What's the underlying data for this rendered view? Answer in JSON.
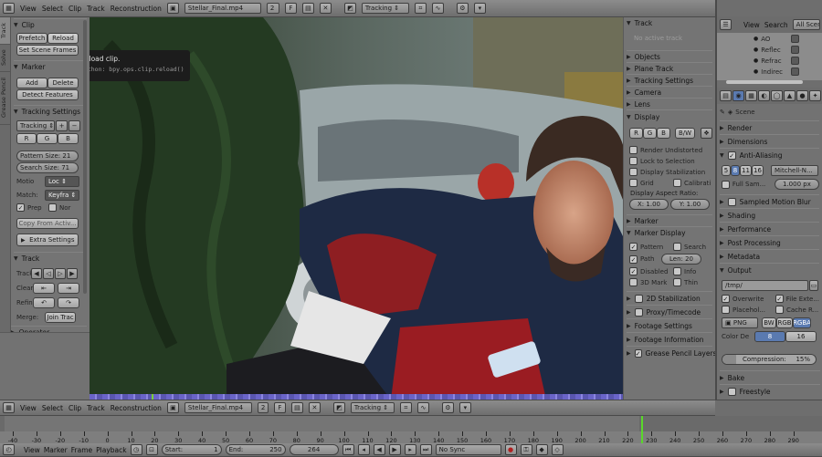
{
  "top_header": {
    "menus": [
      "View",
      "Select",
      "Clip",
      "Track",
      "Reconstruction"
    ],
    "clip_name": "Stellar_Final.mp4",
    "clip_users": "2",
    "mode": "Tracking"
  },
  "left_tabs": [
    "Track",
    "Solve",
    "Grease Pencil"
  ],
  "tool_panel": {
    "clip": {
      "title": "Clip",
      "prefetch": "Prefetch",
      "reload": "Reload",
      "set_scene_frames": "Set Scene Frames"
    },
    "marker": {
      "title": "Marker",
      "add": "Add",
      "delete": "Delete",
      "detect": "Detect Features"
    },
    "tracking_settings": {
      "title": "Tracking Settings",
      "preset": "Tracking",
      "r": "R",
      "g": "G",
      "b": "B",
      "pattern_size": "Pattern Size: 21",
      "search_size": "Search Size: 71",
      "motion_label": "Motio",
      "motion_value": "Loc",
      "match_label": "Match:",
      "match_value": "Keyfra",
      "prepass": "Prep",
      "normalize": "Nor",
      "copy_from_active": "Copy From Activ...",
      "extra_settings": "Extra Settings"
    },
    "track": {
      "title": "Track",
      "track_label": "Track",
      "clear_label": "Clear",
      "refine_label": "Refin",
      "merge_label": "Merge:",
      "join_tracks": "Join Trac"
    },
    "operator_title": "Operator"
  },
  "tooltip": {
    "title": "Reload clip.",
    "python": "Python: bpy.ops.clip.reload()"
  },
  "properties_panel": {
    "track": {
      "title": "Track",
      "empty": "No active track"
    },
    "collapsed": [
      "Objects",
      "Plane Track",
      "Tracking Settings",
      "Camera",
      "Lens"
    ],
    "display": {
      "title": "Display",
      "r": "R",
      "g": "G",
      "b": "B",
      "bw": "B/W",
      "render_undistorted": "Render Undistorted",
      "lock_to_selection": "Lock to Selection",
      "display_stabilization": "Display Stabilization",
      "grid": "Grid",
      "calibration": "Calibrati",
      "aspect_label": "Display Aspect Ratio:",
      "aspect_x": "X: 1.00",
      "aspect_y": "Y: 1.00"
    },
    "marker_title": "Marker",
    "marker_display": {
      "title": "Marker Display",
      "pattern": "Pattern",
      "search": "Search",
      "path": "Path",
      "len": "Len: 20",
      "disabled": "Disabled",
      "info": "Info",
      "mark_3d": "3D Mark",
      "thin": "Thin"
    },
    "bottom": [
      "2D Stabilization",
      "Proxy/Timecode",
      "Footage Settings",
      "Footage Information",
      "Grease Pencil Layers"
    ]
  },
  "outliner": {
    "menus": [
      "View",
      "Search",
      "All Scenes"
    ],
    "items": [
      "AO",
      "Reflec",
      "Refrac",
      "Indirec"
    ]
  },
  "render_props": {
    "scene": "Scene",
    "panels": [
      "Render",
      "Dimensions"
    ],
    "anti_aliasing": {
      "title": "Anti-Aliasing",
      "samples": [
        "5",
        "8",
        "11",
        "16"
      ],
      "filter": "Mitchell-N...",
      "full_sample": "Full Sam...",
      "size": "1.000 px"
    },
    "collapsed": [
      "Sampled Motion Blur",
      "Shading",
      "Performance",
      "Post Processing",
      "Metadata"
    ],
    "output": {
      "title": "Output",
      "path": "/tmp/",
      "overwrite": "Overwrite",
      "file_ext": "File Exte...",
      "placeholders": "Placehol...",
      "cache_result": "Cache R...",
      "format": "PNG",
      "bw": "BW",
      "rgb": "RGB",
      "rgba": "RGBA",
      "color_depth_label": "Color De",
      "depth_8": "8",
      "depth_16": "16",
      "compression": "Compression:",
      "compression_value": "15%",
      "compression_fraction": 0.15
    },
    "bake": "Bake",
    "freestyle": "Freestyle"
  },
  "bottom_header": {
    "menus": [
      "View",
      "Select",
      "Clip",
      "Track",
      "Reconstruction"
    ],
    "clip_name": "Stellar_Final.mp4",
    "clip_users": "2",
    "mode": "Tracking"
  },
  "timeline": {
    "ticks": [
      "-40",
      "-30",
      "-20",
      "-10",
      "0",
      "10",
      "20",
      "30",
      "40",
      "50",
      "60",
      "70",
      "80",
      "90",
      "100",
      "110",
      "120",
      "130",
      "140",
      "150",
      "160",
      "170",
      "180",
      "190",
      "200",
      "210",
      "220",
      "230",
      "240",
      "250",
      "260",
      "270",
      "280",
      "290"
    ],
    "current_frame_value": 264
  },
  "playback_bar": {
    "menus": [
      "View",
      "Marker",
      "Frame",
      "Playback"
    ],
    "start": "Start:",
    "start_value": "1",
    "end": "End:",
    "end_value": "250",
    "current": "264",
    "sync": "No Sync"
  }
}
